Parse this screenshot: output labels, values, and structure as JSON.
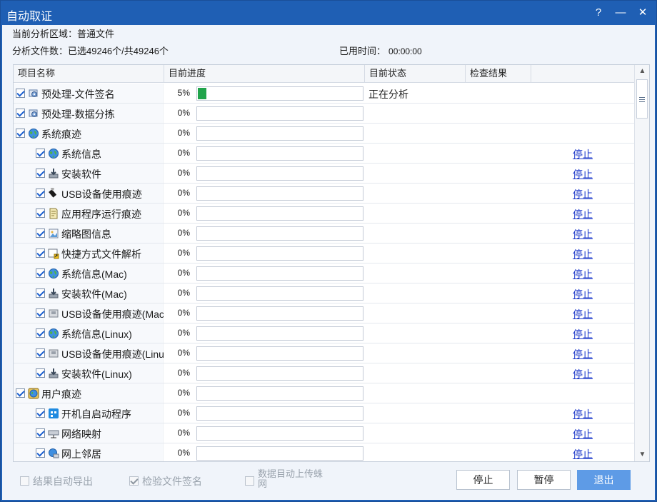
{
  "window": {
    "title": "自动取证",
    "controls": {
      "help": "?",
      "minimize": "—",
      "close": "✕"
    }
  },
  "info": {
    "area_label": "当前分析区域：",
    "area_value": "普通文件",
    "files_label": "分析文件数：",
    "files_value": "已选49246个/共49246个",
    "time_label": "已用时间：",
    "time_value": "00:00:00"
  },
  "columns": [
    "项目名称",
    "目前进度",
    "目前状态",
    "检查结果"
  ],
  "rows": [
    {
      "name": "预处理-文件签名",
      "level": 0,
      "icon": "gear-icon",
      "percent": "5%",
      "progress": 5,
      "status": "正在分析",
      "action": ""
    },
    {
      "name": "预处理-数据分拣",
      "level": 0,
      "icon": "gear-icon",
      "percent": "0%",
      "progress": 0,
      "status": "",
      "action": ""
    },
    {
      "name": "系统痕迹",
      "level": 0,
      "icon": "globe-icon",
      "percent": "0%",
      "progress": 0,
      "status": "",
      "action": ""
    },
    {
      "name": "系统信息",
      "level": 1,
      "icon": "globe-icon",
      "percent": "0%",
      "progress": 0,
      "status": "",
      "action": "停止"
    },
    {
      "name": "安装软件",
      "level": 1,
      "icon": "install-icon",
      "percent": "0%",
      "progress": 0,
      "status": "",
      "action": "停止"
    },
    {
      "name": "USB设备使用痕迹",
      "level": 1,
      "icon": "usb-icon",
      "percent": "0%",
      "progress": 0,
      "status": "",
      "action": "停止"
    },
    {
      "name": "应用程序运行痕迹",
      "level": 1,
      "icon": "document-icon",
      "percent": "0%",
      "progress": 0,
      "status": "",
      "action": "停止"
    },
    {
      "name": "缩略图信息",
      "level": 1,
      "icon": "image-icon",
      "percent": "0%",
      "progress": 0,
      "status": "",
      "action": "停止"
    },
    {
      "name": "快捷方式文件解析",
      "level": 1,
      "icon": "shortcut-icon",
      "percent": "0%",
      "progress": 0,
      "status": "",
      "action": "停止"
    },
    {
      "name": "系统信息(Mac)",
      "level": 1,
      "icon": "globe-icon",
      "percent": "0%",
      "progress": 0,
      "status": "",
      "action": "停止"
    },
    {
      "name": "安装软件(Mac)",
      "level": 1,
      "icon": "install-icon",
      "percent": "0%",
      "progress": 0,
      "status": "",
      "action": "停止"
    },
    {
      "name": "USB设备使用痕迹(Mac)",
      "level": 1,
      "icon": "usb-drive-icon",
      "percent": "0%",
      "progress": 0,
      "status": "",
      "action": "停止"
    },
    {
      "name": "系统信息(Linux)",
      "level": 1,
      "icon": "globe-icon",
      "percent": "0%",
      "progress": 0,
      "status": "",
      "action": "停止"
    },
    {
      "name": "USB设备使用痕迹(Linux)",
      "level": 1,
      "icon": "usb-drive-icon",
      "percent": "0%",
      "progress": 0,
      "status": "",
      "action": "停止"
    },
    {
      "name": "安装软件(Linux)",
      "level": 1,
      "icon": "install-icon",
      "percent": "0%",
      "progress": 0,
      "status": "",
      "action": "停止"
    },
    {
      "name": "用户痕迹",
      "level": 0,
      "icon": "user-globe-icon",
      "percent": "0%",
      "progress": 0,
      "status": "",
      "action": ""
    },
    {
      "name": "开机自启动程序",
      "level": 1,
      "icon": "startup-icon",
      "percent": "0%",
      "progress": 0,
      "status": "",
      "action": "停止"
    },
    {
      "name": "网络映射",
      "level": 1,
      "icon": "network-drive-icon",
      "percent": "0%",
      "progress": 0,
      "status": "",
      "action": "停止"
    },
    {
      "name": "网上邻居",
      "level": 1,
      "icon": "network-icon",
      "percent": "0%",
      "progress": 0,
      "status": "",
      "action": "停止"
    }
  ],
  "options": {
    "auto_export": {
      "label": "结果自动导出",
      "checked": false
    },
    "verify_signature": {
      "label": "检验文件签名",
      "checked": true
    },
    "auto_upload": {
      "label_line1": "数据目动上传蛛",
      "label_line2": "网",
      "checked": false
    }
  },
  "buttons": {
    "stop": "停止",
    "pause": "暂停",
    "exit": "退出"
  },
  "colors": {
    "titlebar": "#1f5fb4",
    "progress": "#21a44b",
    "link": "#1a36c9",
    "exit_button": "#5e9be6"
  }
}
